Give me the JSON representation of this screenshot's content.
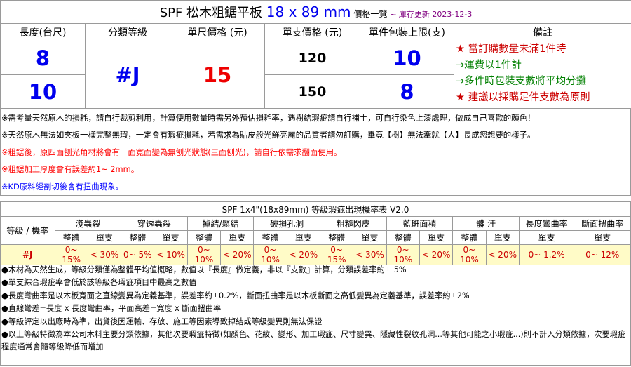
{
  "title": {
    "main": "SPF 松木粗鋸平板 ",
    "size": "18 x 89 mm",
    "price_list": " 價格一覽 ",
    "update": "~ 庫存更新 2023-12-3"
  },
  "headers": [
    "長度(台尺)",
    "分類等級",
    "單尺價格 (元)",
    "單支價格 (元)",
    "單件包裝上限(支)",
    "備註"
  ],
  "rows": [
    {
      "length": "8",
      "unit_price": "120",
      "pack_limit": "10"
    },
    {
      "length": "10",
      "unit_price": "150",
      "pack_limit": "8"
    }
  ],
  "grade": "#J",
  "price_per_foot": "15",
  "remarks": [
    "★ 當訂購數量未滿1件時",
    "→運費以1件計",
    "→多件時包裝支數將平均分攤",
    "★ 建議以採購足件支數為原則"
  ],
  "notes": [
    "※需考量天然原木的損耗，請自行裁剪利用，計算使用數量時需另外預估損耗率，遇樹結瑕疵請自行補土，可自行染色上漆處理，做成自己喜歡的顏色！",
    "※天然原木無法如夾板一樣完整無瑕，一定會有瑕疵損耗，若需求為貼皮般光鮮亮麗的品質者請勿訂購，畢竟【樹】無法牽就【人】長成您想要的樣子。",
    "※粗鋸後，原四面刨光角材將會有一面寬面變為無刨光狀態(三面刨光)，請自行依需求翻面使用。",
    "※粗鋸加工厚度會有誤差約1~ 2mm。",
    "※KD原料經剖切後會有扭曲現象。"
  ],
  "defect": {
    "title": "SPF 1x4\"(18x89mm) 等級瑕疵出現機率表 V2.0",
    "row_header": "等級 / 機率",
    "categories": [
      "淺蟲裂",
      "穿透蟲裂",
      "掉結/鬆結",
      "破損孔洞",
      "粗糙閃皮",
      "藍斑面積",
      "髒 汙",
      "長度彎曲率",
      "斷面扭曲率"
    ],
    "sub_both": [
      "整體",
      "單支"
    ],
    "sub_single": "單支",
    "grade": "#J",
    "values": [
      [
        "0~ 15%",
        "< 30%"
      ],
      [
        "0~ 5%",
        "< 10%"
      ],
      [
        "0~ 10%",
        "< 20%"
      ],
      [
        "0~ 10%",
        "< 20%"
      ],
      [
        "0~ 15%",
        "< 30%"
      ],
      [
        "0~ 10%",
        "< 20%"
      ],
      [
        "0~ 10%",
        "< 20%"
      ],
      [
        "0~ 1.2%"
      ],
      [
        "0~ 12%"
      ]
    ]
  },
  "bottom_notes": [
    "●木材為天然生成，等級分類僅為整體平均值概略，數值以『長度』做定義，非以『支數』計算，分類誤差率約± 5%",
    "●單支綜合瑕疵率會低於該等級各瑕疵項目中最高之數值",
    "●長度彎曲率是以木板寬面之直線變異為定義基準，誤差率約±0.2%，斷面扭曲率是以木板斷面之高低變異為定義基準，誤差率約±2%",
    "●直線彎差=長度 x 長度彎曲率，平面高差=寬度 x 斷面扭曲率",
    "●等級評定以出廠時為準，出貨後因運輸、存放、施工等因素導致掉結或等級變異則無法保證",
    "●以上等級特徵為本公司木料主要分類依據，其他次要瑕疵特徵(如顏色、花紋、變形、加工瑕疵、尺寸變異、隱藏性裂紋孔洞...等其他可能之小瑕疵...)則不計入分類依據，次要瑕疵程度通常會隨等級降低而增加"
  ],
  "colors": {
    "blue": "#0000ee",
    "red": "#ee0000",
    "green": "#008000",
    "purple": "#800080",
    "highlight": "#fffbc7",
    "border": "#9a9a9a"
  }
}
